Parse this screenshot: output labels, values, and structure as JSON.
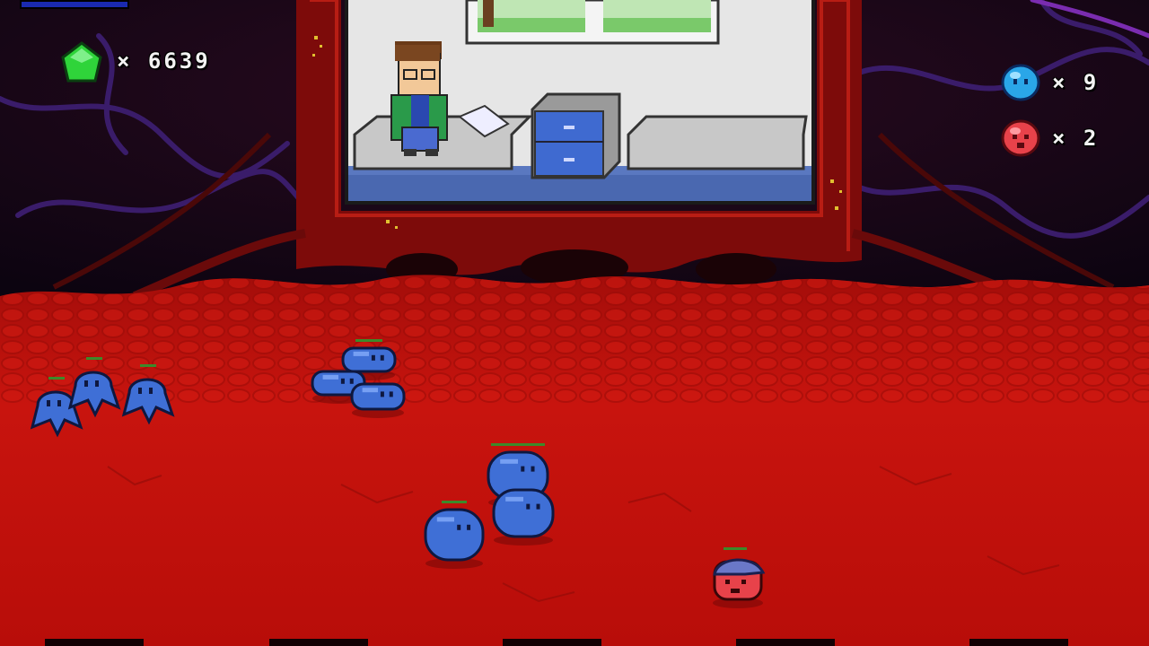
{
  "hud": {
    "gem_icon": "green-gem-icon",
    "gem_count": "× 6639",
    "blue_blob_icon": "blue-blob-face-icon",
    "blue_blob_count": "× 9",
    "red_blob_icon": "red-blob-face-icon",
    "red_blob_count": "× 2"
  },
  "screen": {
    "description_icon": "tv-screen",
    "character": "boy-in-green-jacket"
  },
  "colors": {
    "gem": "#2fd43a",
    "blue_blob": "#3f6fd6",
    "red_blob": "#e8424a",
    "floor": "#c20f0a",
    "flesh": "#8a0c0a",
    "health_bar": "#3c8a2a"
  },
  "units": {
    "blue_blob_count": 9,
    "red_blob_count": 1
  }
}
